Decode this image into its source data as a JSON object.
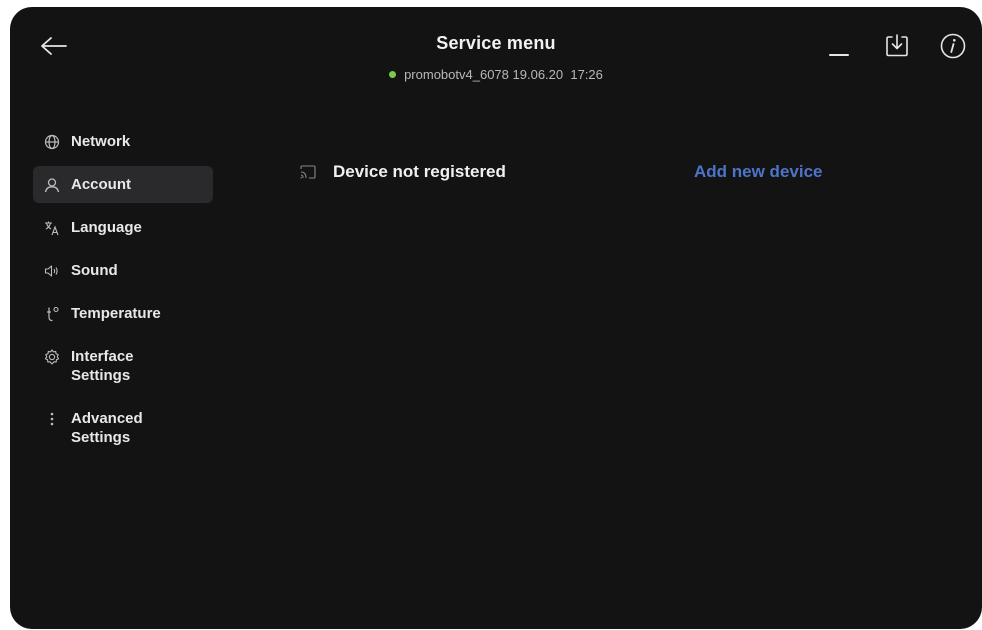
{
  "header": {
    "title": "Service menu",
    "device_id": "promobotv4_6078",
    "date": "19.06.20",
    "time": "17:26",
    "status_color": "#7ec84a"
  },
  "top_icons": [
    "minimize-icon",
    "download-icon",
    "info-icon"
  ],
  "sidebar": {
    "items": [
      {
        "label": "Network",
        "icon": "globe-icon"
      },
      {
        "label": "Account",
        "icon": "person-icon",
        "active": true
      },
      {
        "label": "Language",
        "icon": "translate-icon"
      },
      {
        "label": "Sound",
        "icon": "speaker-icon"
      },
      {
        "label": "Temperature",
        "icon": "thermometer-icon"
      },
      {
        "label": "Interface\nSettings",
        "icon": "gear-icon"
      },
      {
        "label": "Advanced\nSettings",
        "icon": "more-vertical-icon"
      }
    ]
  },
  "main": {
    "device_status": "Device not registered",
    "add_device_label": "Add new device",
    "link_color": "#4d74c9"
  }
}
